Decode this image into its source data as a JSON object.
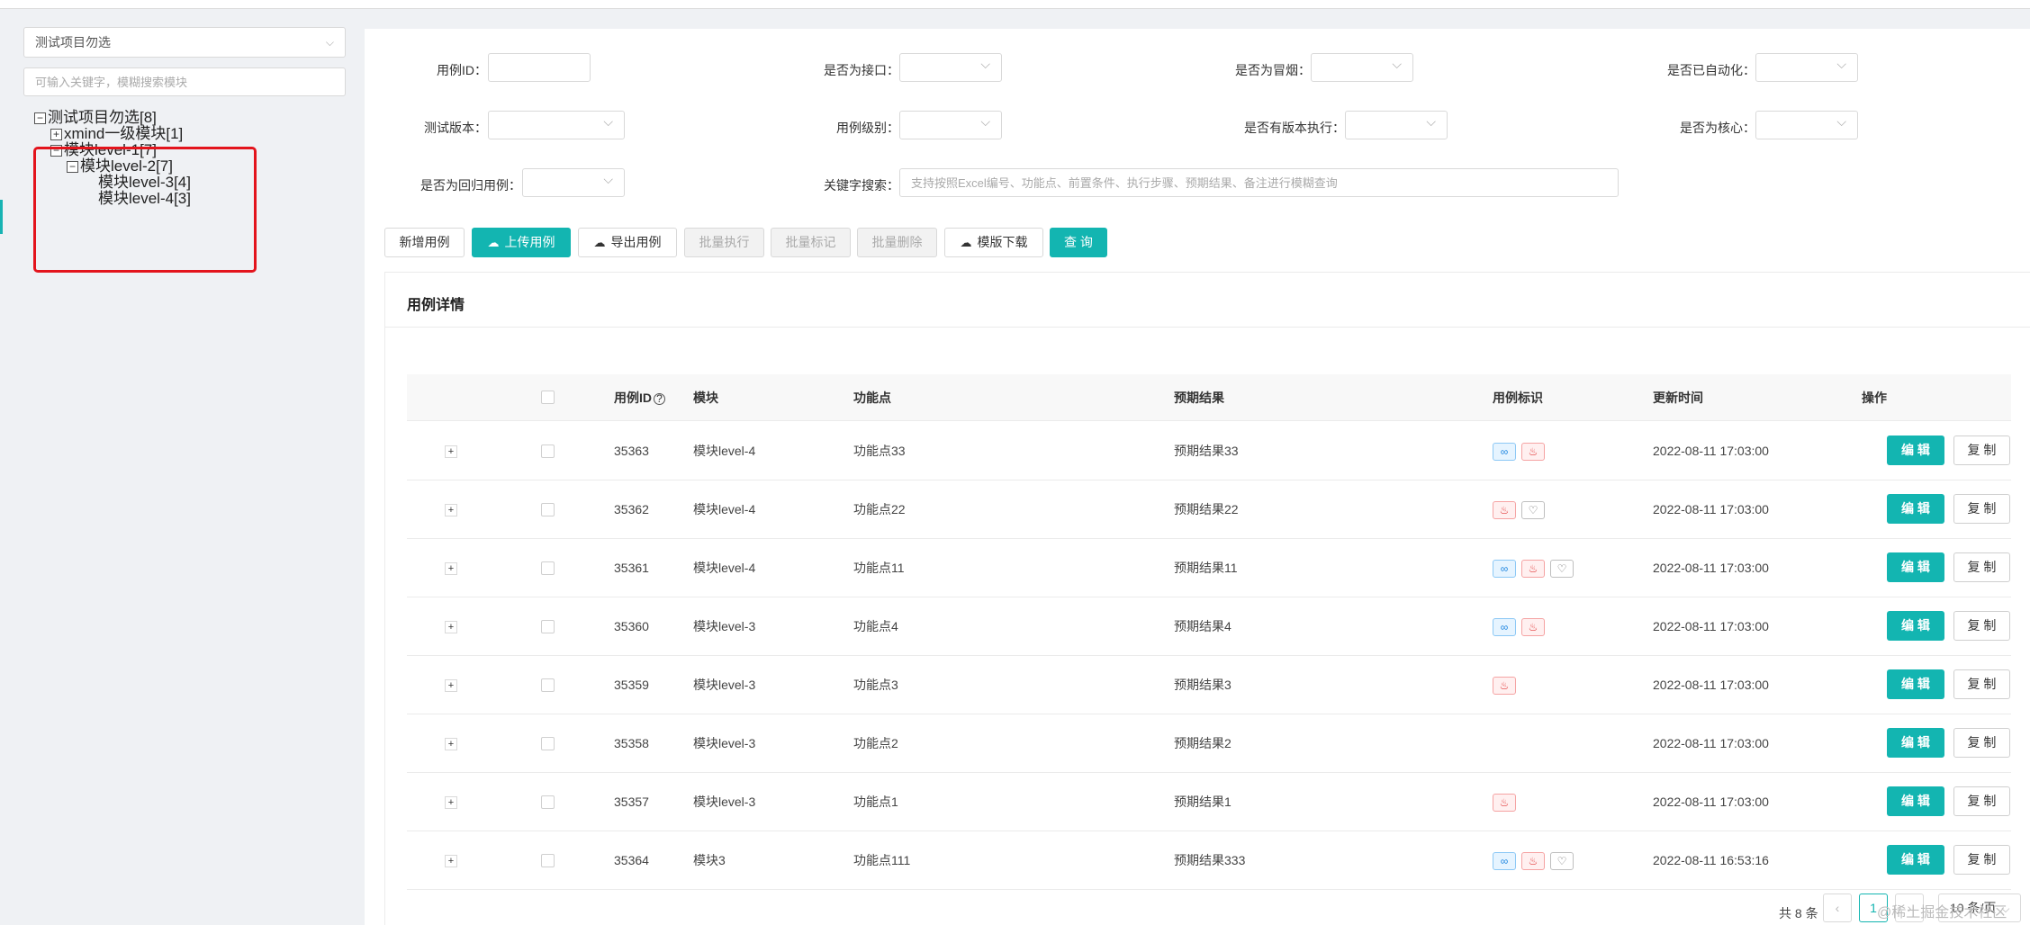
{
  "sidebar": {
    "project_select": "测试项目勿选",
    "search_placeholder": "可输入关键字，模糊搜索模块",
    "tree": [
      {
        "toggle": "−",
        "label": "测试项目勿选[8]"
      },
      {
        "toggle": "+",
        "label": "xmind一级模块[1]"
      },
      {
        "toggle": "−",
        "label": "模块level-1[7]"
      },
      {
        "toggle": "−",
        "label": "模块level-2[7]"
      },
      {
        "toggle": "",
        "label": "模块level-3[4]"
      },
      {
        "toggle": "",
        "label": "模块level-4[3]"
      }
    ]
  },
  "filters": {
    "case_id": "用例ID：",
    "is_api": "是否为接口：",
    "is_smoke": "是否为冒烟：",
    "is_automated": "是否已自动化：",
    "test_version": "测试版本：",
    "case_level": "用例级别：",
    "version_exec": "是否有版本执行：",
    "is_core": "是否为核心：",
    "is_regression": "是否为回归用例：",
    "keyword": "关键字搜索：",
    "keyword_placeholder": "支持按照Excel编号、功能点、前置条件、执行步骤、预期结果、备注进行模糊查询"
  },
  "toolbar": {
    "add": "新增用例",
    "upload": "上传用例",
    "export": "导出用例",
    "batch_exec": "批量执行",
    "batch_mark": "批量标记",
    "batch_delete": "批量删除",
    "template": "模版下载",
    "query": "查 询"
  },
  "table": {
    "title": "用例详情",
    "headers": {
      "id": "用例ID",
      "module": "模块",
      "feature": "功能点",
      "expected": "预期结果",
      "tags": "用例标识",
      "updated": "更新时间",
      "ops": "操作"
    },
    "edit_label": "编 辑",
    "copy_label": "复 制",
    "rows": [
      {
        "id": "35363",
        "module": "模块level-4",
        "feature": "功能点33",
        "expected": "预期结果33",
        "tags": [
          "link",
          "fire"
        ],
        "updated": "2022-08-11 17:03:00"
      },
      {
        "id": "35362",
        "module": "模块level-4",
        "feature": "功能点22",
        "expected": "预期结果22",
        "tags": [
          "fire",
          "heart"
        ],
        "updated": "2022-08-11 17:03:00"
      },
      {
        "id": "35361",
        "module": "模块level-4",
        "feature": "功能点11",
        "expected": "预期结果11",
        "tags": [
          "link",
          "fire",
          "heart"
        ],
        "updated": "2022-08-11 17:03:00"
      },
      {
        "id": "35360",
        "module": "模块level-3",
        "feature": "功能点4",
        "expected": "预期结果4",
        "tags": [
          "link",
          "fire"
        ],
        "updated": "2022-08-11 17:03:00"
      },
      {
        "id": "35359",
        "module": "模块level-3",
        "feature": "功能点3",
        "expected": "预期结果3",
        "tags": [
          "fire"
        ],
        "updated": "2022-08-11 17:03:00"
      },
      {
        "id": "35358",
        "module": "模块level-3",
        "feature": "功能点2",
        "expected": "预期结果2",
        "tags": [],
        "updated": "2022-08-11 17:03:00"
      },
      {
        "id": "35357",
        "module": "模块level-3",
        "feature": "功能点1",
        "expected": "预期结果1",
        "tags": [
          "fire"
        ],
        "updated": "2022-08-11 17:03:00"
      },
      {
        "id": "35364",
        "module": "模块3",
        "feature": "功能点111",
        "expected": "预期结果333",
        "tags": [
          "link",
          "fire",
          "heart"
        ],
        "updated": "2022-08-11 16:53:16"
      }
    ]
  },
  "pagination": {
    "total": "共 8 条",
    "current": "1",
    "page_size": "10 条/页"
  },
  "watermark": "@稀土掘金技术社区",
  "colors": {
    "primary": "#13b5b1",
    "highlight": "#e3141c"
  }
}
